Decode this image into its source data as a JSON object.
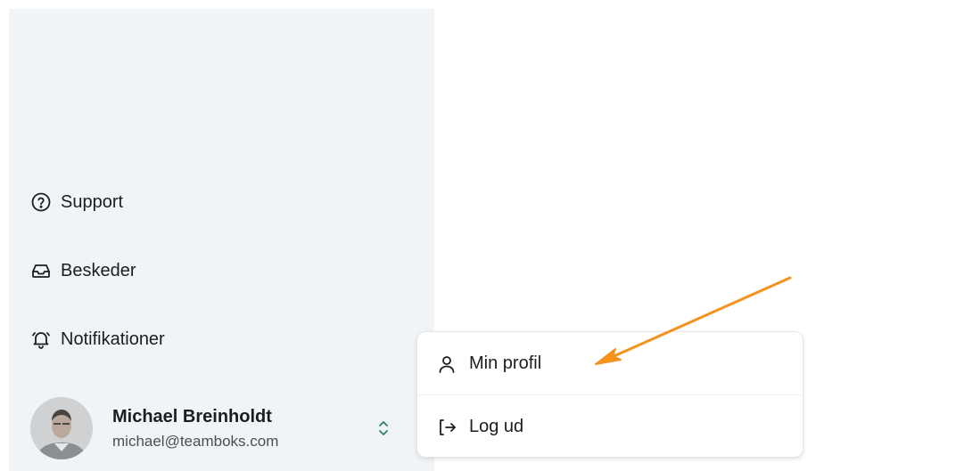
{
  "sidebar": {
    "items": [
      {
        "label": "Support",
        "icon": "help-circle-icon"
      },
      {
        "label": "Beskeder",
        "icon": "inbox-icon"
      },
      {
        "label": "Notifikationer",
        "icon": "bell-icon"
      }
    ],
    "user": {
      "name": "Michael Breinholdt",
      "email": "michael@teamboks.com"
    }
  },
  "menu": {
    "items": [
      {
        "label": "Min profil",
        "icon": "user-icon"
      },
      {
        "label": "Log ud",
        "icon": "logout-icon"
      }
    ]
  },
  "colors": {
    "sidebar_bg": "#f1f4f6",
    "accent_arrow": "#f5921e",
    "chevron": "#2f7d6d"
  }
}
